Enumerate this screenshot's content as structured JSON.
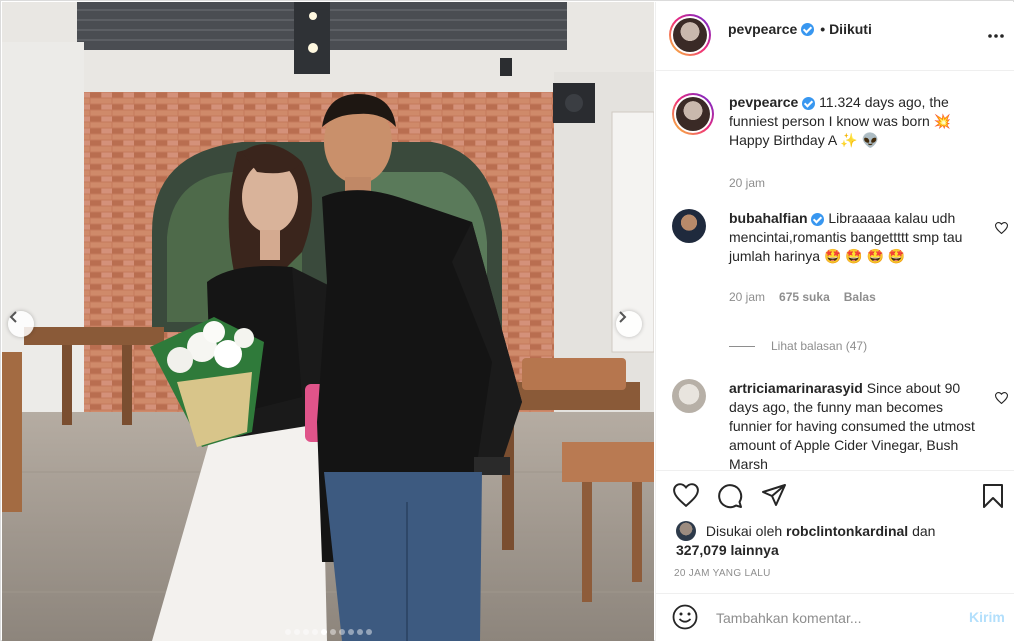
{
  "post": {
    "author": "pevpearce",
    "follow_status": "• Diikuti",
    "more_icon": "more-horizontal-icon",
    "carousel": {
      "total_images": 10,
      "active_index": 4
    }
  },
  "caption": {
    "username": "pevpearce",
    "text": "11.324 days ago, the funniest person I know was born 💥 Happy Birthday A ✨ 👽",
    "time": "20 jam"
  },
  "comments": [
    {
      "username": "bubahalfian",
      "verified": true,
      "text": "Libraaaaa kalau udh mencintai,romantis bangettttt smp tau jumlah harinya 🤩 🤩 🤩 🤩",
      "time": "20 jam",
      "likes": "675 suka",
      "reply": "Balas",
      "view_replies": "Lihat balasan (47)"
    },
    {
      "username": "artriciamarinarasyid",
      "verified": false,
      "text": "Since about 90 days ago, the funny man becomes funnier for having consumed the utmost amount of Apple Cider Vinegar, Bush Marsh"
    }
  ],
  "likes": {
    "prefix": "Disukai oleh",
    "user": "robclintonkardinal",
    "and": "dan",
    "count": "327,079 lainnya"
  },
  "timestamp": "20 JAM YANG LALU",
  "composer": {
    "placeholder": "Tambahkan komentar...",
    "post_label": "Kirim"
  },
  "colors": {
    "verified": "#3897f0",
    "post_button": "#b2dffc",
    "muted_text": "#8e8e8e"
  }
}
